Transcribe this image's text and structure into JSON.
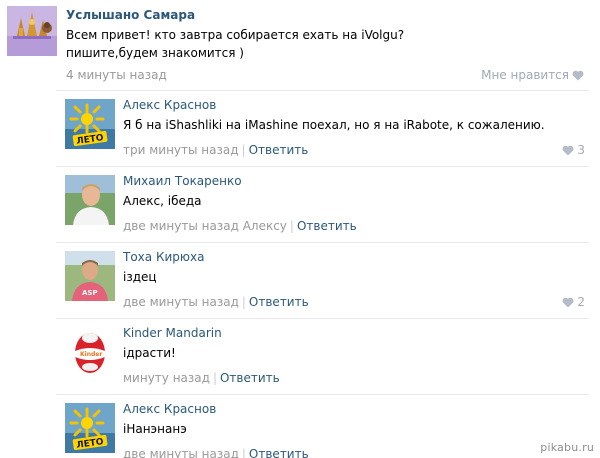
{
  "post": {
    "author": "Услышано Самара",
    "text_line1": "Всем привет! кто завтра собирается ехать на iVolgu?",
    "text_line2": "пишите,будем знакомится )",
    "time": "4 минуты назад",
    "like_label": "Мне нравится"
  },
  "comments": [
    {
      "author": "Алекс Краснов",
      "avatar_icon": "sun-leto-icon",
      "text": "Я б на iShashliki на iMashine поехал, но я на iRabote, к сожалению.",
      "time": "три минуты назад",
      "reply_to": "",
      "reply_label": "Ответить",
      "likes": "3"
    },
    {
      "author": "Михаил Токаренко",
      "avatar_icon": "person-photo-icon",
      "text": "Алекс, iбеда",
      "time": "две минуты назад",
      "reply_to": "Алексу",
      "reply_label": "Ответить",
      "likes": ""
    },
    {
      "author": "Тоха Кирюха",
      "avatar_icon": "person-photo-icon",
      "text": "iздец",
      "time": "две минуты назад",
      "reply_to": "",
      "reply_label": "Ответить",
      "likes": "2"
    },
    {
      "author": "Kinder Mandarin",
      "avatar_icon": "kinder-egg-icon",
      "text": "iдрасти!",
      "time": "минуту назад",
      "reply_to": "",
      "reply_label": "Ответить",
      "likes": ""
    },
    {
      "author": "Алекс Краснов",
      "avatar_icon": "sun-leto-icon",
      "text": "iНанэнанэ",
      "time": "две минуты назад",
      "reply_to": "",
      "reply_label": "Ответить",
      "likes": ""
    }
  ],
  "watermark": "pikabu.ru",
  "colors": {
    "link": "#2b587a",
    "muted": "#999999",
    "like": "#a0a9b4",
    "divider": "#e7e8ec"
  }
}
